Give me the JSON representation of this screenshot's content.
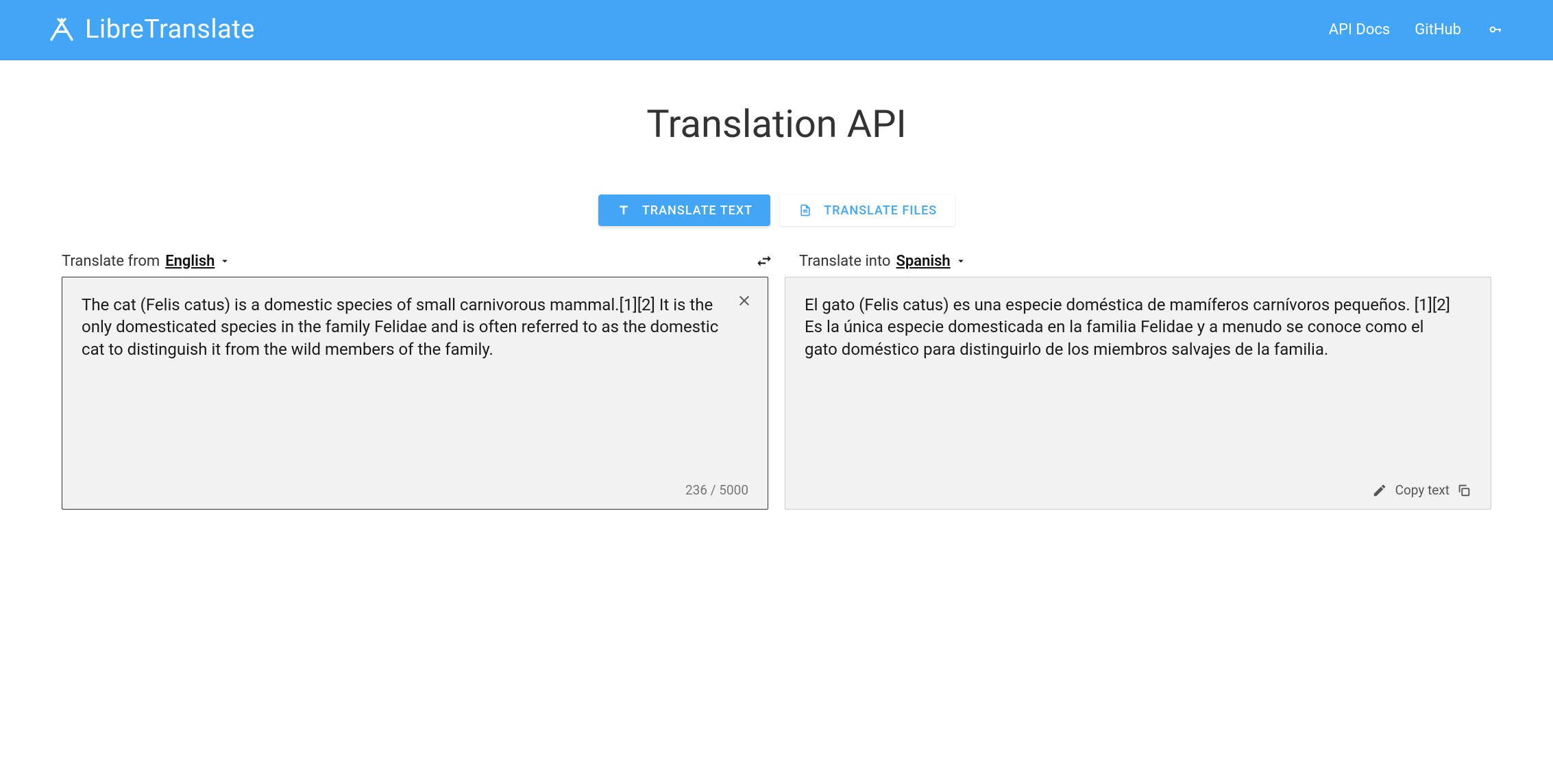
{
  "header": {
    "brand": "LibreTranslate",
    "nav": {
      "api_docs": "API Docs",
      "github": "GitHub"
    }
  },
  "main": {
    "title": "Translation API",
    "tabs": {
      "text": "TRANSLATE TEXT",
      "files": "TRANSLATE FILES"
    },
    "source": {
      "label": "Translate from",
      "lang": "English",
      "text": "The cat (Felis catus) is a domestic species of small carnivorous mammal.[1][2] It is the only domesticated species in the family Felidae and is often referred to as the domestic cat to distinguish it from the wild members of the family.",
      "char_count": "236 / 5000"
    },
    "target": {
      "label": "Translate into",
      "lang": "Spanish",
      "text": "El gato (Felis catus) es una especie doméstica de mamíferos carnívoros pequeños. [1][2] Es la única especie domesticada en la familia Felidae y a menudo se conoce como el gato doméstico para distinguirlo de los miembros salvajes de la familia.",
      "copy_label": "Copy text"
    }
  }
}
